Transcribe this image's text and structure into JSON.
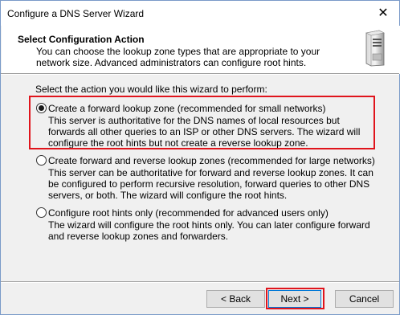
{
  "window": {
    "title": "Configure a DNS Server Wizard",
    "close_glyph": "✕"
  },
  "header": {
    "title": "Select Configuration Action",
    "description": "You can choose the lookup zone types that are appropriate to your network size. Advanced administrators can configure root hints.",
    "icon": "server-icon"
  },
  "main": {
    "prompt": "Select the action you would like this wizard to perform:",
    "options": [
      {
        "label": "Create a forward lookup zone (recommended for small networks)",
        "description": "This server is authoritative for the DNS names of local resources but forwards all other queries to an ISP or other DNS servers. The wizard will configure the root hints but not create a reverse lookup zone.",
        "selected": true
      },
      {
        "label": "Create forward and reverse lookup zones (recommended for large networks)",
        "description": "This server can be authoritative for forward and reverse lookup zones. It can be configured to perform recursive resolution, forward queries to other DNS servers, or both. The wizard will configure the root hints.",
        "selected": false
      },
      {
        "label": "Configure root hints only (recommended for advanced users only)",
        "description": "The wizard will configure the root hints only. You can later configure forward and reverse lookup zones and forwarders.",
        "selected": false
      }
    ]
  },
  "footer": {
    "back_label": "< Back",
    "next_label": "Next >",
    "cancel_label": "Cancel"
  },
  "colors": {
    "highlight": "#e0141c",
    "focus_border": "#0078d7"
  }
}
